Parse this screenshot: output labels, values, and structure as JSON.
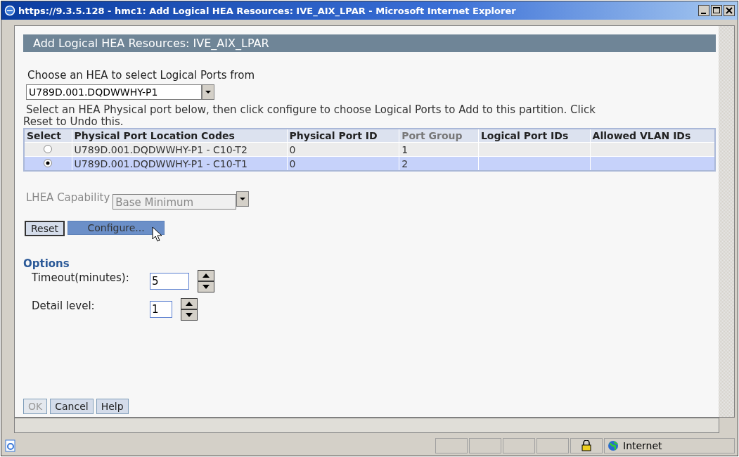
{
  "window": {
    "title": "https://9.3.5.128 - hmc1: Add Logical HEA Resources: IVE_AIX_LPAR - Microsoft Internet Explorer"
  },
  "page_title": "Add Logical HEA Resources: IVE_AIX_LPAR",
  "hea_prompt": "Choose an HEA to select Logical Ports from",
  "hea_select": {
    "value": "U789D.001.DQDWWHY-P1"
  },
  "instructions": "Select an HEA Physical port below, then click configure to choose Logical Ports to Add to this partition. Click Reset to Undo this.",
  "table": {
    "columns": [
      "Select",
      "Physical Port Location Codes",
      "Physical Port ID",
      "Port Group",
      "Logical Port IDs",
      "Allowed VLAN IDs"
    ],
    "rows": [
      {
        "selected": false,
        "location": "U789D.001.DQDWWHY-P1 - C10-T2",
        "port_id": "0",
        "port_group": "1"
      },
      {
        "selected": true,
        "location": "U789D.001.DQDWWHY-P1 - C10-T1",
        "port_id": "0",
        "port_group": "2"
      }
    ]
  },
  "lhea_capability": {
    "label": "LHEA Capability",
    "value": "Base Minimum",
    "disabled": true
  },
  "action_buttons": [
    {
      "label": "Reset",
      "hover": false
    },
    {
      "label": "Configure...",
      "hover": true
    }
  ],
  "options": {
    "heading": "Options",
    "fields": [
      {
        "label": "Timeout(minutes):",
        "value": "5"
      },
      {
        "label": "Detail level:",
        "value": "1"
      }
    ]
  },
  "footer_buttons": [
    {
      "label": "OK",
      "disabled": true
    },
    {
      "label": "Cancel",
      "disabled": false
    },
    {
      "label": "Help",
      "disabled": false
    }
  ],
  "status_bar": {
    "zone": "Internet"
  }
}
